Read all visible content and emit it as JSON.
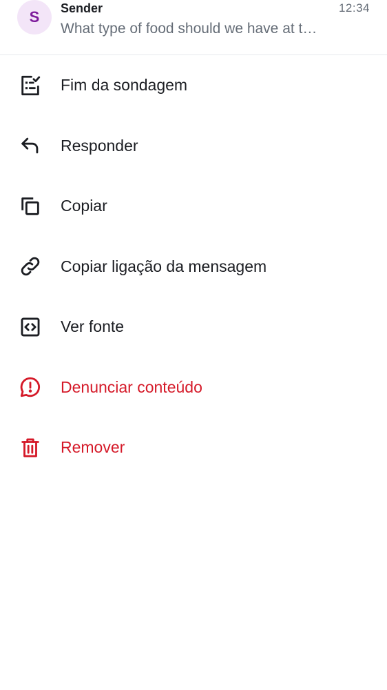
{
  "message": {
    "avatar_letter": "S",
    "sender": "Sender",
    "preview": "What type of food should we have at the party?",
    "time": "12:34"
  },
  "menu": {
    "items": [
      {
        "label": "Fim da sondagem",
        "icon": "poll-end-icon"
      },
      {
        "label": "Responder",
        "icon": "reply-icon"
      },
      {
        "label": "Copiar",
        "icon": "copy-icon"
      },
      {
        "label": "Copiar ligação da mensagem",
        "icon": "link-icon"
      },
      {
        "label": "Ver fonte",
        "icon": "view-source-icon"
      },
      {
        "label": "Denunciar conteúdo",
        "icon": "report-icon",
        "color": "#d51928"
      },
      {
        "label": "Remover",
        "icon": "trash-icon",
        "color": "#d51928"
      }
    ]
  },
  "colors": {
    "text": "#1b1d22",
    "secondary": "#656d77",
    "danger": "#d51928",
    "avatar_bg": "#f3e5f8",
    "avatar_fg": "#7d1b9b"
  }
}
